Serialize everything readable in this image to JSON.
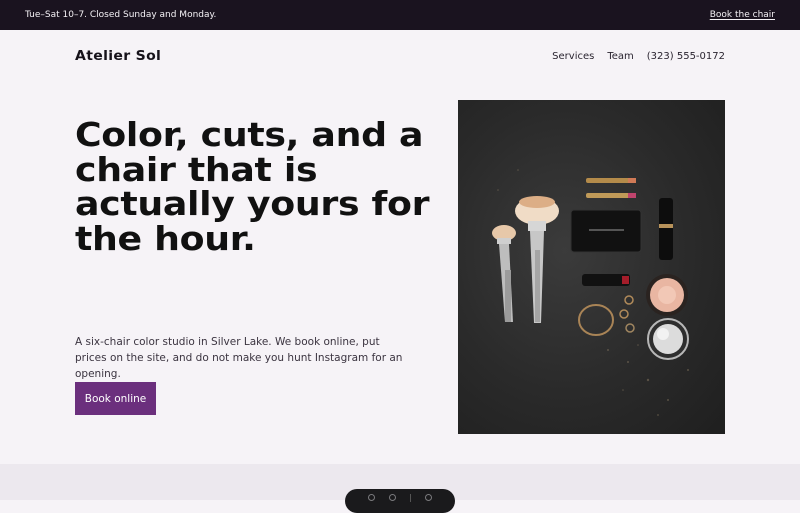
{
  "topbar": {
    "hours": "Tue–Sat 10–7. Closed Sunday and Monday.",
    "cta_link": "Book the chair"
  },
  "header": {
    "brand": "Atelier Sol",
    "nav": {
      "services": "Services",
      "team": "Team",
      "phone": "(323) 555-0172"
    }
  },
  "hero": {
    "headline": "Color, cuts, and a chair that is actually yours for the hour.",
    "lede": "A six-chair color studio in Silver Lake. We book online, put prices on the site, and do not make you hunt Instagram for an opening.",
    "cta": "Book online"
  },
  "colors": {
    "topbar_bg": "#1a131f",
    "page_bg": "#f6f3f7",
    "accent": "#6b2f7d",
    "photo_bg": "#2e2e2e"
  },
  "icons": [
    "chat-icon",
    "phone-icon",
    "menu-icon",
    "globe-icon"
  ]
}
